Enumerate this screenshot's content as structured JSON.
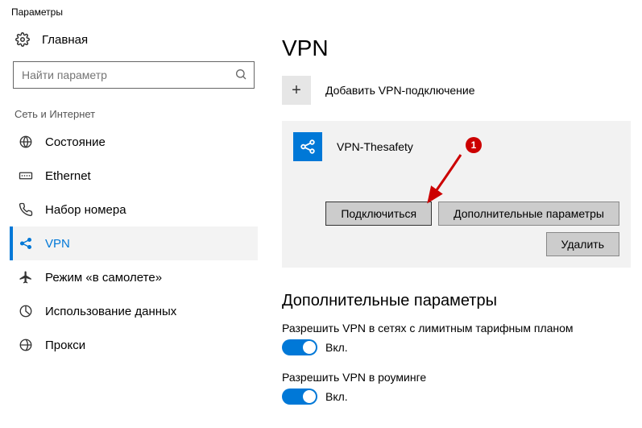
{
  "window": {
    "title": "Параметры"
  },
  "sidebar": {
    "home": "Главная",
    "search_placeholder": "Найти параметр",
    "category": "Сеть и Интернет",
    "items": [
      {
        "label": "Состояние"
      },
      {
        "label": "Ethernet"
      },
      {
        "label": "Набор номера"
      },
      {
        "label": "VPN"
      },
      {
        "label": "Режим «в самолете»"
      },
      {
        "label": "Использование данных"
      },
      {
        "label": "Прокси"
      }
    ]
  },
  "main": {
    "title": "VPN",
    "add_label": "Добавить VPN-подключение",
    "vpn": {
      "name": "VPN-Thesafety",
      "btn_connect": "Подключиться",
      "btn_advanced": "Дополнительные параметры",
      "btn_delete": "Удалить"
    },
    "extra_title": "Дополнительные параметры",
    "metered_label": "Разрешить VPN в сетях с лимитным тарифным планом",
    "roaming_label": "Разрешить VPN в роуминге",
    "toggle_on": "Вкл."
  },
  "annotation": {
    "n": "1"
  }
}
